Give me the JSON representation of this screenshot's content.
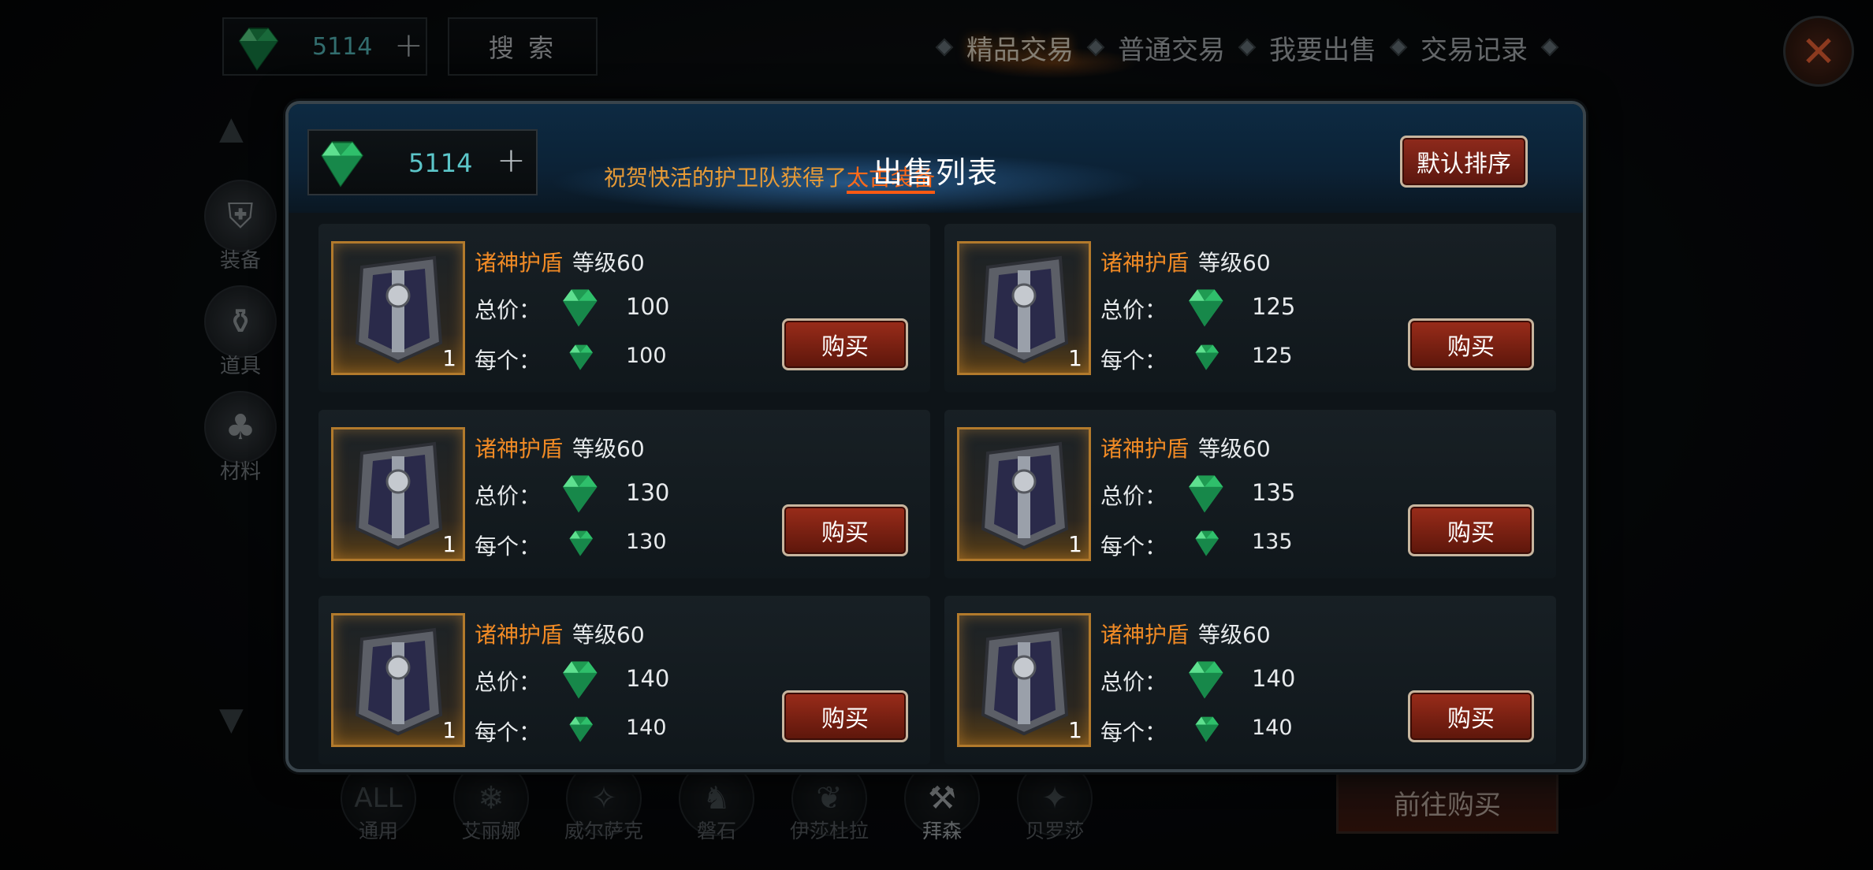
{
  "currency": {
    "amount": "5114",
    "plus": "+"
  },
  "search": {
    "label": "搜 索"
  },
  "tabs": [
    {
      "label": "精品交易",
      "active": true
    },
    {
      "label": "普通交易",
      "active": false
    },
    {
      "label": "我要出售",
      "active": false
    },
    {
      "label": "交易记录",
      "active": false
    }
  ],
  "sidebar": [
    {
      "label": "装备",
      "icon": "armor-icon"
    },
    {
      "label": "道具",
      "icon": "potion-icon"
    },
    {
      "label": "材料",
      "icon": "material-bag-icon"
    }
  ],
  "heroes": [
    {
      "label": "通用",
      "icon": "all-icon",
      "glyph": "ALL"
    },
    {
      "label": "艾丽娜",
      "icon": "snowflake-icon",
      "glyph": "❄"
    },
    {
      "label": "威尔萨克",
      "icon": "feather-icon",
      "glyph": "✧"
    },
    {
      "label": "磐石",
      "icon": "beast-icon",
      "glyph": "♞"
    },
    {
      "label": "伊莎杜拉",
      "icon": "wings-icon",
      "glyph": "❦"
    },
    {
      "label": "拜森",
      "icon": "hammer-icon",
      "glyph": "⚒"
    },
    {
      "label": "贝罗莎",
      "icon": "flame-icon",
      "glyph": "✦"
    }
  ],
  "goto_buy": "前往购买",
  "modal": {
    "title": "出售列表",
    "ticker_prefix": "祝贺快活的护卫队获得了",
    "ticker_highlight": "太古装备",
    "sort_label": "默认排序",
    "total_label": "总价：",
    "each_label": "每个：",
    "buy_label": "购买",
    "listings": [
      {
        "name": "诸神护盾",
        "level": "等级60",
        "total": "100",
        "each": "100",
        "qty": "1"
      },
      {
        "name": "诸神护盾",
        "level": "等级60",
        "total": "125",
        "each": "125",
        "qty": "1"
      },
      {
        "name": "诸神护盾",
        "level": "等级60",
        "total": "130",
        "each": "130",
        "qty": "1"
      },
      {
        "name": "诸神护盾",
        "level": "等级60",
        "total": "135",
        "each": "135",
        "qty": "1"
      },
      {
        "name": "诸神护盾",
        "level": "等级60",
        "total": "140",
        "each": "140",
        "qty": "1"
      },
      {
        "name": "诸神护盾",
        "level": "等级60",
        "total": "140",
        "each": "140",
        "qty": "1"
      }
    ]
  },
  "colors": {
    "accent_orange": "#f08a25",
    "gem_green": "#27c76a",
    "button_red": "#8f2a1c"
  }
}
